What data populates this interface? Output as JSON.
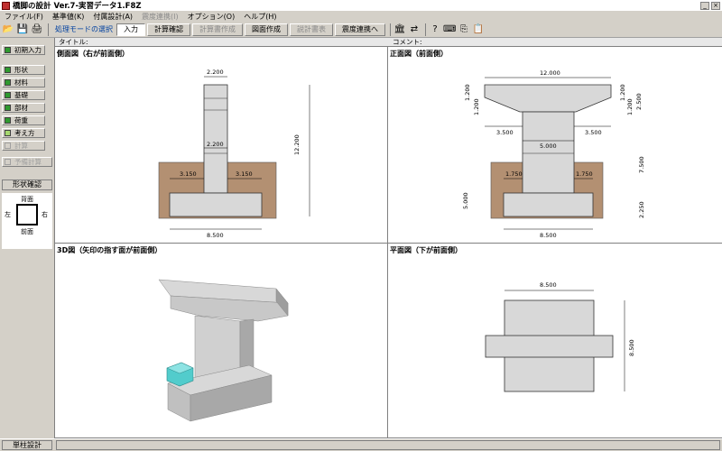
{
  "window": {
    "title": "橋脚の設計 Ver.7-実習データ1.F8Z",
    "minimize": "_",
    "close": "×"
  },
  "menu": [
    {
      "label": "ファイル(F)",
      "disabled": false
    },
    {
      "label": "基準値(K)",
      "disabled": false
    },
    {
      "label": "付属設計(A)",
      "disabled": false
    },
    {
      "label": "震度連携(I)",
      "disabled": true
    },
    {
      "label": "オプション(O)",
      "disabled": false
    },
    {
      "label": "ヘルプ(H)",
      "disabled": false
    }
  ],
  "toolbar": {
    "mode_label": "処理モードの選択",
    "buttons": [
      {
        "label": "入力",
        "state": "pressed"
      },
      {
        "label": "計算確認",
        "state": "normal"
      },
      {
        "label": "計算書作成",
        "state": "disabled"
      },
      {
        "label": "図面作成",
        "state": "normal"
      },
      {
        "label": "説計書表",
        "state": "disabled"
      },
      {
        "label": "震度連携へ",
        "state": "normal"
      }
    ]
  },
  "sidebar": {
    "initial": "初期入力",
    "items": [
      {
        "label": "形状",
        "check": "green",
        "disabled": false
      },
      {
        "label": "材料",
        "check": "green",
        "disabled": false
      },
      {
        "label": "基礎",
        "check": "green",
        "disabled": false
      },
      {
        "label": "部材",
        "check": "green",
        "disabled": false
      },
      {
        "label": "荷重",
        "check": "green",
        "disabled": false
      },
      {
        "label": "考え方",
        "check": "lime",
        "disabled": false
      },
      {
        "label": "計算",
        "check": "gray",
        "disabled": true
      },
      {
        "label": "予備計算",
        "check": "gray",
        "disabled": true
      }
    ],
    "shape_confirm": "形状確認",
    "orientation": {
      "back": "背面",
      "front": "前面",
      "left": "左",
      "right": "右"
    }
  },
  "canvas": {
    "title_label": "タイトル:",
    "comment_label": "コメント:",
    "side_view": {
      "title": "側面図（右が前面側）",
      "dims": {
        "top": "2.200",
        "mid": "2.200",
        "left_step": "3.150",
        "right_step": "3.150",
        "bottom": "8.500",
        "height": "12.200"
      }
    },
    "front_view": {
      "title": "正面図（前面側）",
      "dims": {
        "top": "12.000",
        "l1": "1.200",
        "l2": "1.200",
        "r1": "1.200",
        "r2": "1.200",
        "r3": "2.500",
        "cap_left": "3.500",
        "cap_right": "3.500",
        "col": "5.000",
        "left_h": "5.000",
        "right_h": "7.500",
        "foot_left": "1.750",
        "foot_right": "1.750",
        "bottom": "8.500",
        "right_bottom": "2.250"
      }
    },
    "view_3d": {
      "title": "3D図（矢印の指す面が前面側）"
    },
    "plan_view": {
      "title": "平面図（下が前面側）",
      "dims": {
        "top": "8.500",
        "right": "8.500"
      }
    }
  },
  "status": {
    "mode": "単柱設計"
  },
  "colors": {
    "soil": "#b39072",
    "concrete": "#d8d8d8",
    "accent": "#52cccc"
  }
}
